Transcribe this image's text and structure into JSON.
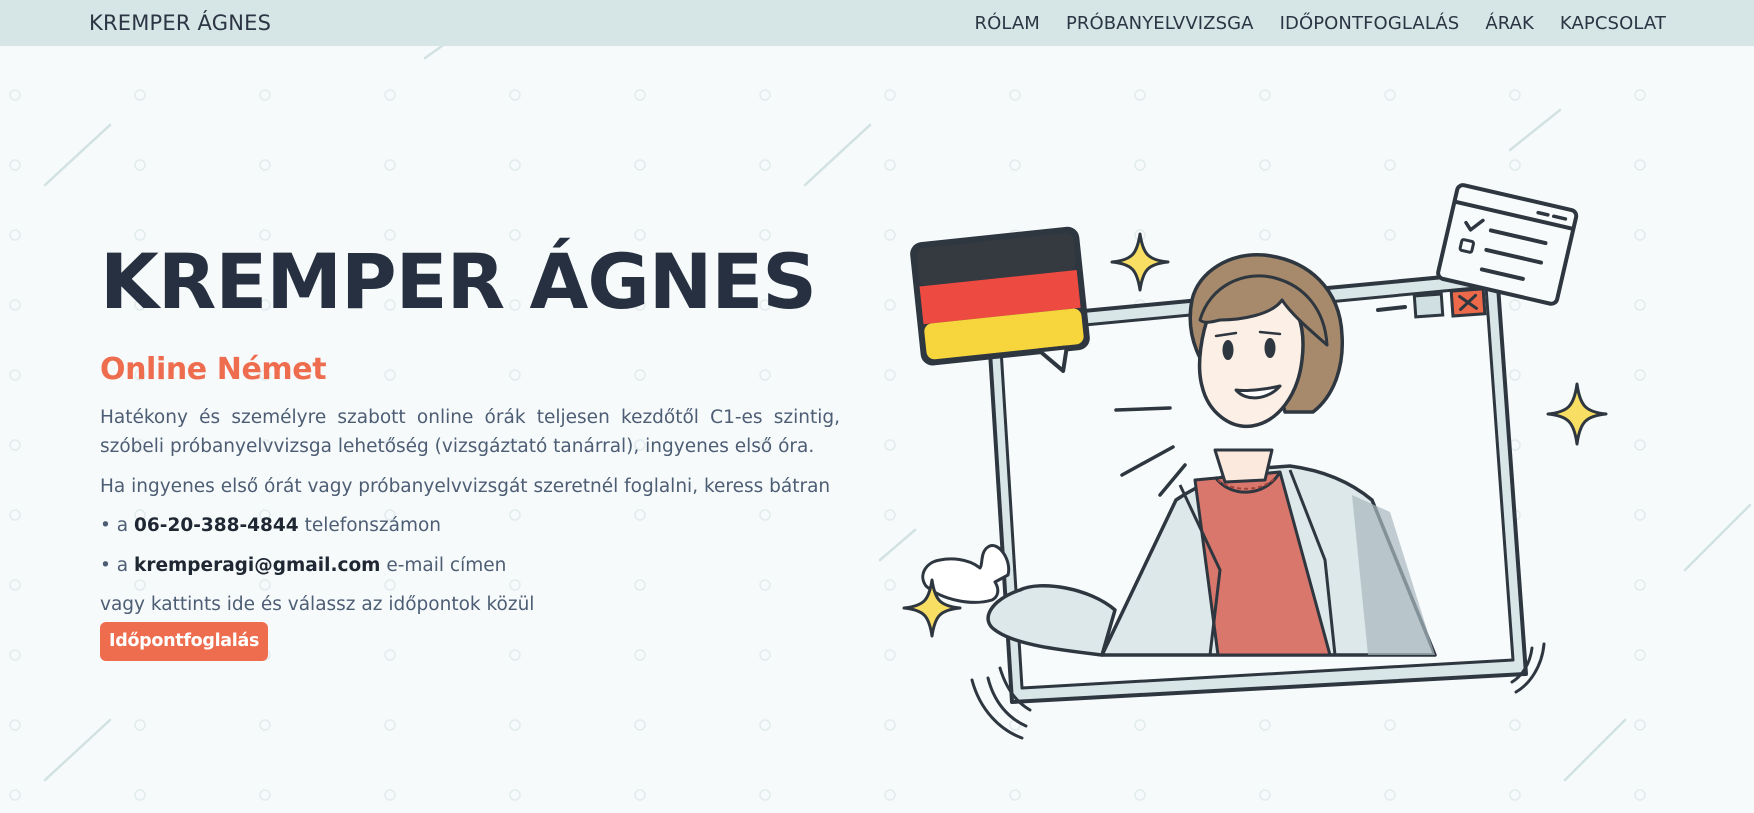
{
  "header": {
    "brand": "KREMPER ÁGNES",
    "nav": [
      {
        "label": "RÓLAM"
      },
      {
        "label": "PRÓBANYELVVIZSGA"
      },
      {
        "label": "IDŐPONTFOGLALÁS"
      },
      {
        "label": "ÁRAK"
      },
      {
        "label": "KAPCSOLAT"
      }
    ]
  },
  "hero": {
    "title": "KREMPER ÁGNES",
    "subtitle": "Online Német",
    "intro": "Hatékony és személyre szabott online órák teljesen kezdőtől C1-es szintig, szóbeli próbanyelvvizsga lehetőség (vizsgáztató tanárral), ingyenes első óra.",
    "booking_text": "Ha ingyenes első órát vagy próbanyelvvizsgát szeretnél foglalni, keress bátran",
    "phone": {
      "prefix": "• a",
      "value": "06-20-388-4844",
      "suffix": "telefonszámon"
    },
    "email": {
      "prefix": "• a",
      "value": "kremperagi@gmail.com",
      "suffix": "e-mail címen"
    },
    "click_text": "vagy kattints ide és válassz az időpontok közül",
    "cta_label": "Időpontfoglalás"
  },
  "colors": {
    "accent": "#ef6d4f",
    "navbar_bg": "#d6e5e5",
    "page_bg": "#f6fafb",
    "heading": "#263040",
    "body_text": "#4d5d74"
  },
  "illustration": {
    "icons": [
      "german-flag-speech-bubble-icon",
      "browser-window-icon",
      "checklist-window-icon",
      "sparkle-icon",
      "close-window-icon"
    ]
  }
}
